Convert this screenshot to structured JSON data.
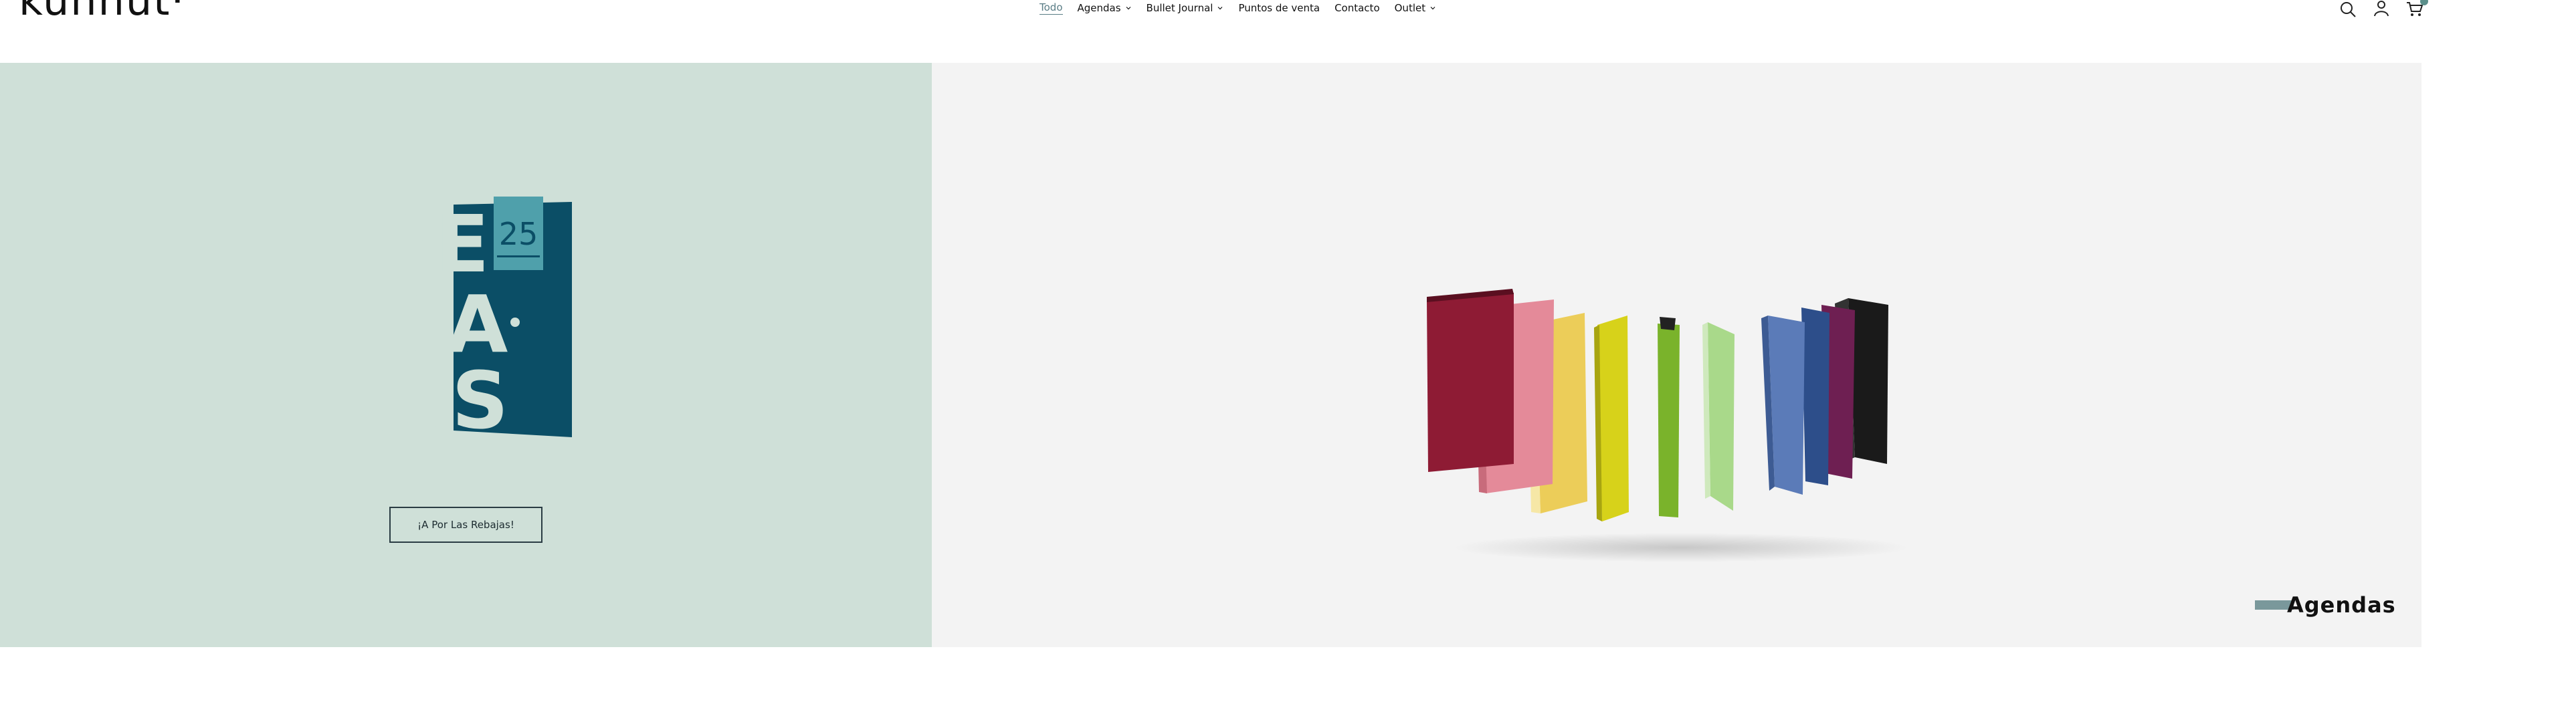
{
  "header": {
    "logo": "kunnut·",
    "nav": [
      {
        "label": "Todo",
        "active": true,
        "dropdown": false
      },
      {
        "label": "Agendas",
        "active": false,
        "dropdown": true
      },
      {
        "label": "Bullet Journal",
        "active": false,
        "dropdown": true
      },
      {
        "label": "Puntos de venta",
        "active": false,
        "dropdown": false
      },
      {
        "label": "Contacto",
        "active": false,
        "dropdown": false
      },
      {
        "label": "Outlet",
        "active": false,
        "dropdown": true
      }
    ],
    "icons": [
      "search-icon",
      "user-icon",
      "cart-icon"
    ]
  },
  "hero_left": {
    "promo_logo": {
      "lines": [
        "RE",
        "BA",
        "JAS"
      ],
      "number": "25"
    },
    "cta_label": "¡A Por Las Rebajas!",
    "colors": {
      "background": "#cfe0d8",
      "logo_dark": "#0b4e66",
      "logo_light": "#cfe0d8",
      "logo_accent": "#4fa0ab"
    }
  },
  "hero_right": {
    "caption": "Agendas",
    "colors": {
      "background": "#f3f3f3",
      "caption_bar": "#7a989b"
    },
    "book_colors": [
      "#8e1b34",
      "#e48a99",
      "#eccd59",
      "#d7d21a",
      "#7ab32b",
      "#a9d98a",
      "#5b7bb8",
      "#2d4e8a",
      "#6e1f52",
      "#1a1a1a"
    ]
  }
}
